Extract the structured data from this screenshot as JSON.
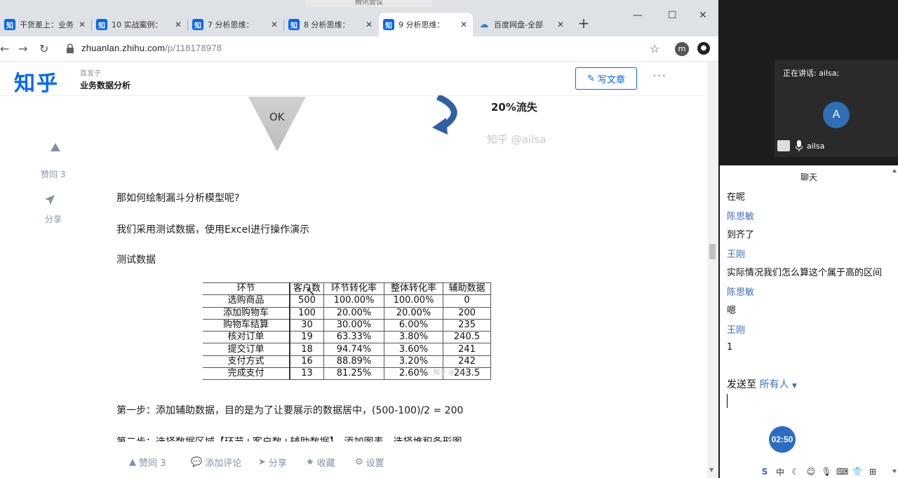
{
  "browser": {
    "meeting_bar": "腾讯会议",
    "tabs": [
      {
        "favicon": "知",
        "label": "干货差上：业务",
        "active": false
      },
      {
        "favicon": "知",
        "label": "10 实战案例：",
        "active": false
      },
      {
        "favicon": "知",
        "label": "7 分析思维：",
        "active": false
      },
      {
        "favicon": "知",
        "label": "8 分析思维：",
        "active": false
      },
      {
        "favicon": "知",
        "label": "9 分析思维：",
        "active": true
      },
      {
        "favicon": "cloud-icon",
        "label": "百度网盘-全部",
        "active": false
      }
    ],
    "url_host": "zhuanlan.zhihu.com",
    "url_path": "/p/118178978",
    "profile_initial": "m"
  },
  "zhihu": {
    "logo": "知乎",
    "publisher_label": "首发于",
    "column_title": "业务数据分析",
    "write_button": "写文章",
    "figure": {
      "ok_label": "OK",
      "loss_label": "20%流失",
      "watermark": "知乎 @ailsa"
    },
    "side": {
      "like_label": "赞同 3",
      "share_label": "分享"
    },
    "paragraphs": {
      "p1": "那如何绘制漏斗分析模型呢?",
      "p2": "我们采用测试数据，使用Excel进行操作演示",
      "p3": "测试数据",
      "p4": "第一步：添加辅助数据，目的是为了让要展示的数据居中，(500-100)/2 = 200",
      "p5": "第二步：选择数据区域【环节+客户数+辅助数据】，添加图表，选择堆积条形图"
    },
    "table": {
      "headers": [
        "环节",
        "客户数",
        "环节转化率",
        "整体转化率",
        "辅助数据"
      ],
      "rows": [
        [
          "选购商品",
          "500",
          "100.00%",
          "100.00%",
          "0"
        ],
        [
          "添加购物车",
          "100",
          "20.00%",
          "20.00%",
          "200"
        ],
        [
          "购物车结算",
          "30",
          "30.00%",
          "6.00%",
          "235"
        ],
        [
          "核对订单",
          "19",
          "63.33%",
          "3.80%",
          "240.5"
        ],
        [
          "提交订单",
          "18",
          "94.74%",
          "3.60%",
          "241"
        ],
        [
          "支付方式",
          "16",
          "88.89%",
          "3.20%",
          "242"
        ],
        [
          "完成支付",
          "13",
          "81.25%",
          "2.60%",
          "243.5"
        ]
      ],
      "watermark": "知乎 @ailsa"
    },
    "actions": {
      "like": "赞同 3",
      "comment": "添加评论",
      "share": "分享",
      "favorite": "收藏",
      "settings": "设置"
    }
  },
  "meeting": {
    "speaking_label": "正在讲话: ailsa;",
    "avatar_letter": "A",
    "participant_name": "ailsa",
    "chat_title": "聊天",
    "messages": [
      {
        "type": "body",
        "text": "在呢"
      },
      {
        "type": "sender",
        "text": "陈思敏"
      },
      {
        "type": "body",
        "text": "到齐了"
      },
      {
        "type": "sender",
        "text": "王刚"
      },
      {
        "type": "body",
        "text": "实际情况我们怎么算这个属于高的区间"
      },
      {
        "type": "sender",
        "text": "陈思敏"
      },
      {
        "type": "body",
        "text": "嗯"
      },
      {
        "type": "sender",
        "text": "王刚"
      },
      {
        "type": "body",
        "text": "1"
      }
    ],
    "send_to_label": "发送至",
    "send_to_target": "所有人",
    "timer": "02:50",
    "ime_label": "中"
  },
  "colors": {
    "zhihu_blue": "#0066ff",
    "meeting_blue": "#2b6cc4",
    "sender_blue": "#3d6dbe"
  }
}
